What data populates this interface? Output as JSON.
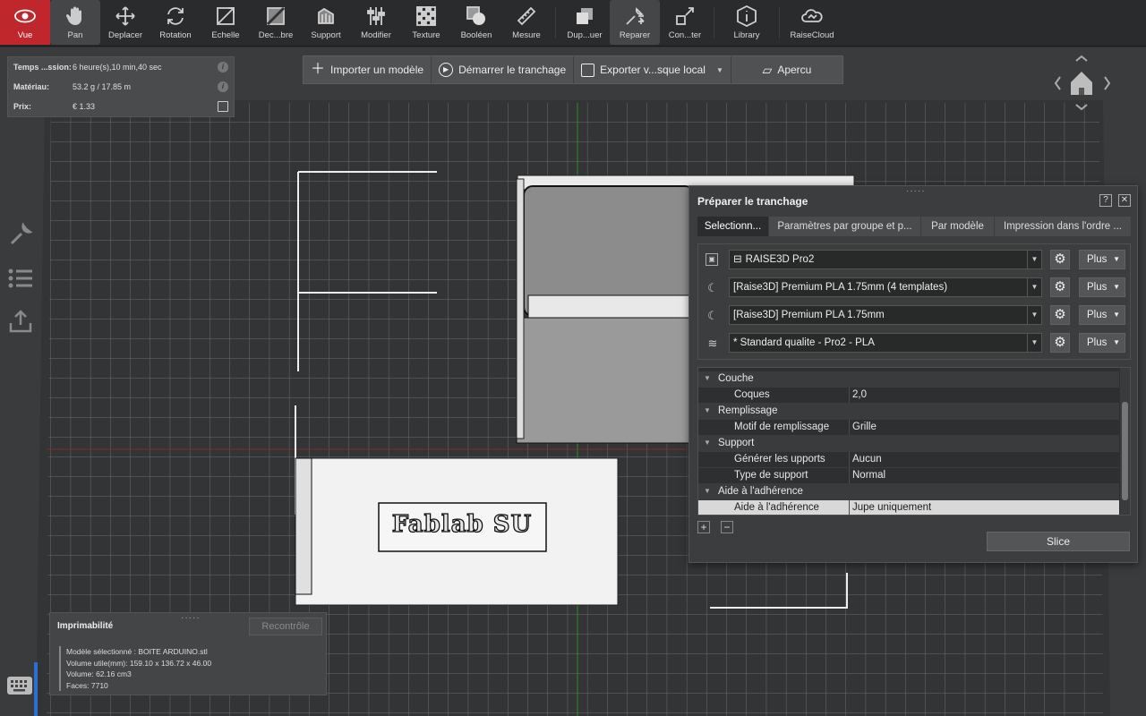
{
  "toolbar": {
    "tools": [
      {
        "label": "Vue",
        "icon": "eye-icon"
      },
      {
        "label": "Pan",
        "icon": "hand-icon"
      },
      {
        "label": "Deplacer",
        "icon": "move-icon"
      },
      {
        "label": "Rotation",
        "icon": "rotate-icon"
      },
      {
        "label": "Echelle",
        "icon": "scale-icon"
      },
      {
        "label": "Dec...bre",
        "icon": "cut-icon"
      },
      {
        "label": "Support",
        "icon": "support-icon"
      },
      {
        "label": "Modifier",
        "icon": "sliders-icon"
      },
      {
        "label": "Texture",
        "icon": "texture-icon"
      },
      {
        "label": "Booléen",
        "icon": "boolean-icon"
      },
      {
        "label": "Mesure",
        "icon": "ruler-icon"
      },
      {
        "label": "Dup...uer",
        "icon": "duplicate-icon"
      },
      {
        "label": "Reparer",
        "icon": "wrench-icon"
      },
      {
        "label": "Con...ter",
        "icon": "convert-icon"
      },
      {
        "label": "Library",
        "icon": "info-icon"
      },
      {
        "label": "RaiseCloud",
        "icon": "cloud-icon"
      }
    ]
  },
  "info": {
    "time_label": "Temps ...ssion:",
    "time_value": "6 heure(s),10 min,40 sec",
    "material_label": "Matériau:",
    "material_value": "53.2 g / 17.85 m",
    "price_label": "Prix:",
    "price_value": "€ 1.33"
  },
  "actions": {
    "import": "Importer un modèle",
    "start": "Démarrer le tranchage",
    "export": "Exporter v...sque local",
    "preview": "Apercu"
  },
  "prep": {
    "title": "Préparer le tranchage",
    "help": "?",
    "close": "✕",
    "tabs": [
      "Selectionn...",
      "Paramètres par groupe et p...",
      "Par modèle",
      "Impression dans l'ordre ..."
    ],
    "printer": "RAISE3D Pro2",
    "material1": "[Raise3D] Premium PLA 1.75mm (4 templates)",
    "material2": "[Raise3D] Premium PLA 1.75mm",
    "quality": "* Standard qualite - Pro2 - PLA",
    "more": "Plus",
    "tree": {
      "g_couche": "Couche",
      "p_coques": "Coques",
      "v_coques": "2,0",
      "g_remplissage": "Remplissage",
      "p_motif": "Motif de remplissage",
      "v_motif": "Grille",
      "g_support": "Support",
      "p_generer": "Générer les upports",
      "v_generer": "Aucun",
      "p_type": "Type de support",
      "v_type": "Normal",
      "g_aide": "Aide à l'adhérence",
      "p_aide": "Aide à l'adhérence",
      "v_aide": "Jupe uniquement"
    },
    "add": "+",
    "remove": "−",
    "slice": "Slice"
  },
  "printability": {
    "title": "Imprimabilité",
    "recheck": "Recontrôle",
    "model": "Modèle sélectionné : BOITE ARDUINO.stl",
    "volume_used": "Volume utile(mm): 159.10 x 136.72 x 46.00",
    "volume": "Volume: 62.16 cm3",
    "faces": "Faces: 7710"
  },
  "model_label": "Fablab SU"
}
